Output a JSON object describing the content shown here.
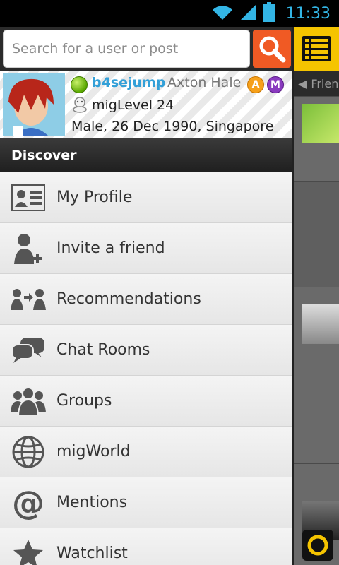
{
  "status_bar": {
    "time": "11:33",
    "icons": [
      "wifi-icon",
      "signal-icon",
      "battery-icon"
    ]
  },
  "search": {
    "placeholder": "Search for a user or post",
    "value": ""
  },
  "profile": {
    "username": "b4sejump",
    "full_name": "Axton Hale",
    "badges": [
      "A",
      "M"
    ],
    "level_text": "migLevel 24",
    "details": "Male, 26 Dec 1990, Singapore"
  },
  "section": {
    "title": "Discover"
  },
  "menu": [
    {
      "label": "My Profile",
      "icon": "profile-card-icon"
    },
    {
      "label": "Invite a friend",
      "icon": "add-person-icon"
    },
    {
      "label": "Recommendations",
      "icon": "recommend-icon"
    },
    {
      "label": "Chat Rooms",
      "icon": "chat-bubbles-icon"
    },
    {
      "label": "Groups",
      "icon": "group-icon"
    },
    {
      "label": "migWorld",
      "icon": "globe-icon"
    },
    {
      "label": "Mentions",
      "icon": "at-icon"
    },
    {
      "label": "Watchlist",
      "icon": "star-icon"
    }
  ],
  "peek": {
    "tab_label": "Frien"
  },
  "colors": {
    "accent_yellow": "#f5c400",
    "search_orange": "#f05a24",
    "username_blue": "#33a0d8",
    "status_blue": "#33b5e5"
  }
}
